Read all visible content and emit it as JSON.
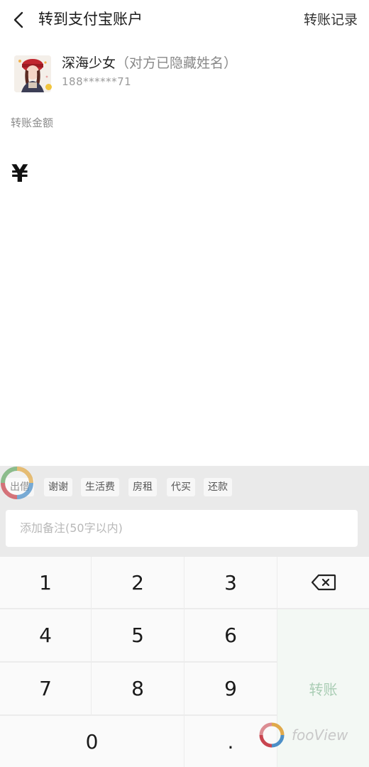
{
  "header": {
    "title": "转到支付宝账户",
    "history_label": "转账记录"
  },
  "recipient": {
    "name": "深海少女",
    "name_note": "（对方已隐藏姓名）",
    "account": "188******71"
  },
  "amount": {
    "label": "转账金额",
    "currency": "¥"
  },
  "chips": [
    "出借",
    "谢谢",
    "生活费",
    "房租",
    "代买",
    "还款"
  ],
  "note": {
    "placeholder": "添加备注(50字以内)"
  },
  "keypad": {
    "keys": [
      "1",
      "2",
      "3",
      "4",
      "5",
      "6",
      "7",
      "8",
      "9",
      "0",
      "."
    ],
    "delete_icon": "backspace-icon",
    "submit_label": "转账"
  },
  "watermark": {
    "text": "fooView"
  }
}
